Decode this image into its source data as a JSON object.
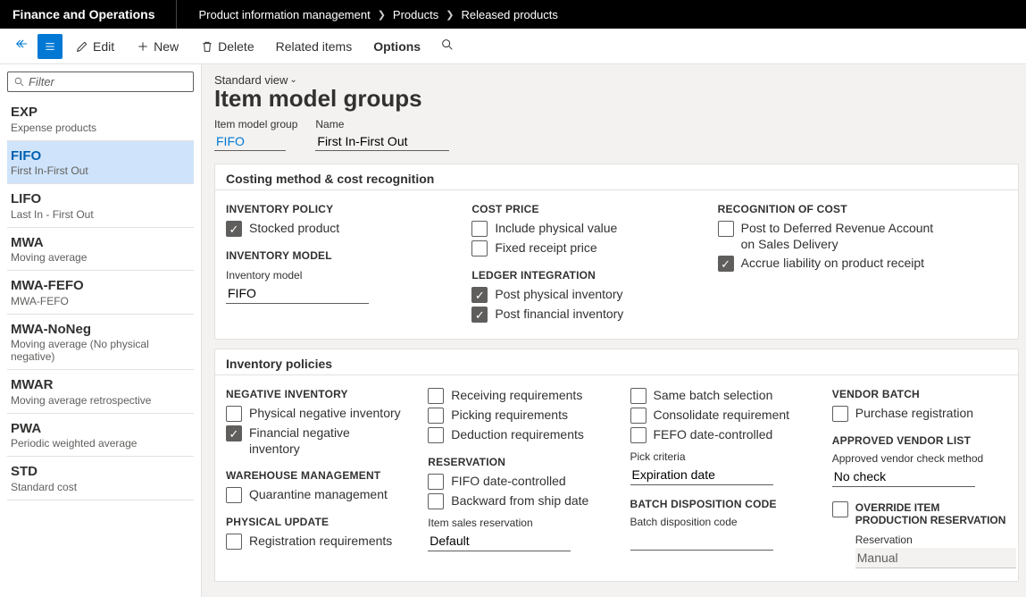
{
  "topbar": {
    "title": "Finance and Operations",
    "breadcrumb": [
      "Product information management",
      "Products",
      "Released products"
    ]
  },
  "toolbar": {
    "edit": "Edit",
    "new": "New",
    "delete": "Delete",
    "related": "Related items",
    "options": "Options"
  },
  "sidebar": {
    "filter_placeholder": "Filter",
    "items": [
      {
        "code": "EXP",
        "desc": "Expense products"
      },
      {
        "code": "FIFO",
        "desc": "First In-First Out"
      },
      {
        "code": "LIFO",
        "desc": "Last In - First Out"
      },
      {
        "code": "MWA",
        "desc": "Moving average"
      },
      {
        "code": "MWA-FEFO",
        "desc": "MWA-FEFO"
      },
      {
        "code": "MWA-NoNeg",
        "desc": "Moving average (No physical negative)"
      },
      {
        "code": "MWAR",
        "desc": "Moving average retrospective"
      },
      {
        "code": "PWA",
        "desc": "Periodic weighted average"
      },
      {
        "code": "STD",
        "desc": "Standard cost"
      }
    ],
    "active_index": 1
  },
  "main": {
    "view_label": "Standard view",
    "page_title": "Item model groups",
    "fields": {
      "group_label": "Item model group",
      "group_value": "FIFO",
      "name_label": "Name",
      "name_value": "First In-First Out"
    }
  },
  "panels": {
    "costing": {
      "title": "Costing method & cost recognition",
      "inventory_policy": "INVENTORY POLICY",
      "stocked_product": "Stocked product",
      "inventory_model_h": "INVENTORY MODEL",
      "inventory_model_l": "Inventory model",
      "inventory_model_v": "FIFO",
      "cost_price": "COST PRICE",
      "include_physical": "Include physical value",
      "fixed_receipt": "Fixed receipt price",
      "ledger_integration": "LEDGER INTEGRATION",
      "post_physical": "Post physical inventory",
      "post_financial": "Post financial inventory",
      "recognition": "RECOGNITION OF COST",
      "post_deferred": "Post to Deferred Revenue Account on Sales Delivery",
      "accrue": "Accrue liability on product receipt"
    },
    "policies": {
      "title": "Inventory policies",
      "neg_inv": "NEGATIVE INVENTORY",
      "phys_neg": "Physical negative inventory",
      "fin_neg": "Financial negative inventory",
      "wm": "WAREHOUSE MANAGEMENT",
      "quarantine": "Quarantine management",
      "phys_update": "PHYSICAL UPDATE",
      "reg_req": "Registration requirements",
      "recv_req": "Receiving requirements",
      "pick_req": "Picking requirements",
      "ded_req": "Deduction requirements",
      "reservation": "RESERVATION",
      "fifo_date": "FIFO date-controlled",
      "backward": "Backward from ship date",
      "item_sales_res_l": "Item sales reservation",
      "item_sales_res_v": "Default",
      "same_batch": "Same batch selection",
      "consolidate": "Consolidate requirement",
      "fefo_date": "FEFO date-controlled",
      "pick_crit_l": "Pick criteria",
      "pick_crit_v": "Expiration date",
      "batch_disp_h": "BATCH DISPOSITION CODE",
      "batch_disp_l": "Batch disposition code",
      "vendor_batch": "VENDOR BATCH",
      "purch_reg": "Purchase registration",
      "avl_h": "APPROVED VENDOR LIST",
      "avl_l": "Approved vendor check method",
      "avl_v": "No check",
      "override_h": "OVERRIDE ITEM PRODUCTION RESERVATION",
      "override_res_l": "Reservation",
      "override_res_v": "Manual"
    }
  }
}
